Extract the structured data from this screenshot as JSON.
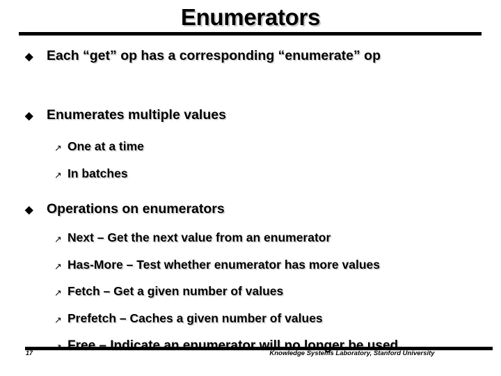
{
  "slide": {
    "title": "Enumerators",
    "bullets": [
      {
        "level": 1,
        "marker": "diamond-bullet",
        "marker_glyph": "◆",
        "text": "Each “get” op has a corresponding “enumerate” op"
      },
      {
        "level": 1,
        "marker": "diamond-bullet",
        "marker_glyph": "◆",
        "text": "Enumerates multiple values"
      },
      {
        "level": 2,
        "marker": "arrow-bullet",
        "marker_glyph": "↗",
        "text": "One at a time"
      },
      {
        "level": 2,
        "marker": "arrow-bullet",
        "marker_glyph": "↗",
        "text": "In batches"
      },
      {
        "level": 1,
        "marker": "diamond-bullet",
        "marker_glyph": "◆",
        "text": "Operations on enumerators"
      },
      {
        "level": 2,
        "marker": "arrow-bullet",
        "marker_glyph": "↗",
        "text": "Next – Get the next value from an enumerator"
      },
      {
        "level": 2,
        "marker": "arrow-bullet",
        "marker_glyph": "↗",
        "text": "Has-More – Test whether enumerator has more values"
      },
      {
        "level": 2,
        "marker": "arrow-bullet",
        "marker_glyph": "↗",
        "text": "Fetch – Get a given number of values"
      },
      {
        "level": 2,
        "marker": "arrow-bullet",
        "marker_glyph": "↗",
        "text": "Prefetch – Caches a given number of values"
      },
      {
        "level": 2,
        "marker": "arrow-bullet",
        "marker_glyph": "↗",
        "text": "Free – Indicate an enumerator will no longer be used"
      }
    ],
    "footer": {
      "slide_number": "17",
      "organization": "Knowledge Systems Laboratory, Stanford University"
    },
    "colors": {
      "text": "#000000",
      "background": "#ffffff",
      "shadow": "#d2d2d2"
    }
  }
}
